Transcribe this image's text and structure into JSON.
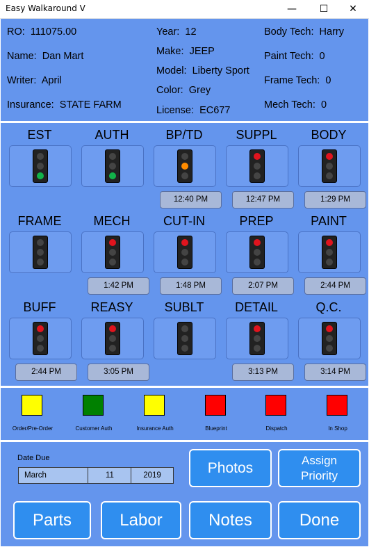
{
  "window": {
    "title": "Easy Walkaround V",
    "minimize": "—",
    "maximize": "☐",
    "close": "✕"
  },
  "info": {
    "ro_label": "RO:",
    "ro_value": "111075.00",
    "name_label": "Name:",
    "name_value": "Dan Mart",
    "writer_label": "Writer:",
    "writer_value": "April",
    "insurance_label": "Insurance:",
    "insurance_value": "STATE FARM",
    "year_label": "Year:",
    "year_value": "12",
    "make_label": "Make:",
    "make_value": "JEEP",
    "model_label": "Model:",
    "model_value": "Liberty Sport",
    "color_label": "Color:",
    "color_value": "Grey",
    "license_label": "License:",
    "license_value": "EC677",
    "body_tech_label": "Body Tech:",
    "body_tech_value": "Harry",
    "paint_tech_label": "Paint Tech:",
    "paint_tech_value": "0",
    "frame_tech_label": "Frame Tech:",
    "frame_tech_value": "0",
    "mech_tech_label": "Mech Tech:",
    "mech_tech_value": "0"
  },
  "stages": [
    {
      "name": "EST",
      "light": "green",
      "time": ""
    },
    {
      "name": "AUTH",
      "light": "green",
      "time": ""
    },
    {
      "name": "BP/TD",
      "light": "yellow",
      "time": "12:40 PM"
    },
    {
      "name": "SUPPL",
      "light": "red",
      "time": "12:47 PM"
    },
    {
      "name": "BODY",
      "light": "red",
      "time": "1:29 PM"
    },
    {
      "name": "FRAME",
      "light": "off",
      "time": ""
    },
    {
      "name": "MECH",
      "light": "red",
      "time": "1:42 PM"
    },
    {
      "name": "CUT-IN",
      "light": "red",
      "time": "1:48 PM"
    },
    {
      "name": "PREP",
      "light": "red",
      "time": "2:07 PM"
    },
    {
      "name": "PAINT",
      "light": "red",
      "time": "2:44 PM"
    },
    {
      "name": "BUFF",
      "light": "red",
      "time": "2:44 PM"
    },
    {
      "name": "REASY",
      "light": "red",
      "time": "3:05 PM"
    },
    {
      "name": "SUBLT",
      "light": "off",
      "time": ""
    },
    {
      "name": "DETAIL",
      "light": "red",
      "time": "3:13 PM"
    },
    {
      "name": "Q.C.",
      "light": "red",
      "time": "3:14 PM"
    }
  ],
  "light_colors": {
    "red": "#e0141e",
    "yellow": "#ff8c00",
    "green": "#12b24a",
    "off": "#444444"
  },
  "legend": [
    {
      "label": "Order/Pre-Order",
      "color": "#ffff00"
    },
    {
      "label": "Customer Auth",
      "color": "#008000"
    },
    {
      "label": "Insurance Auth",
      "color": "#ffff00"
    },
    {
      "label": "Blueprint",
      "color": "#ff0000"
    },
    {
      "label": "Dispatch",
      "color": "#ff0000"
    },
    {
      "label": "In Shop",
      "color": "#ff0000"
    }
  ],
  "date_due": {
    "label": "Date Due",
    "month": "March",
    "day": "11",
    "year": "2019"
  },
  "buttons": {
    "photos": "Photos",
    "assign_priority_line1": "Assign",
    "assign_priority_line2": "Priority",
    "parts": "Parts",
    "labor": "Labor",
    "notes": "Notes",
    "done": "Done"
  }
}
